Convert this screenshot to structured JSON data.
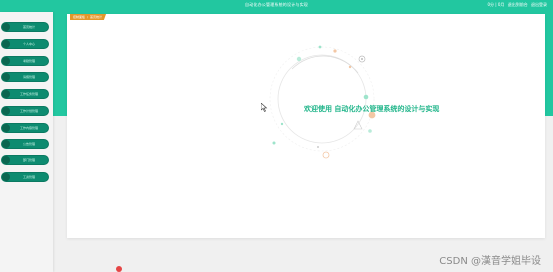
{
  "header": {
    "title": "自动化办公管理系统的设计与实现",
    "user_links": [
      "0分 | 0月",
      "退出到前台",
      "退出登录"
    ]
  },
  "sidebar": {
    "items": [
      {
        "label": "首页统计"
      },
      {
        "label": "个人中心"
      },
      {
        "label": "考勤管理"
      },
      {
        "label": "请假管理"
      },
      {
        "label": "工作任务管理"
      },
      {
        "label": "工作计划管理"
      },
      {
        "label": "工作内容管理"
      },
      {
        "label": "公告管理"
      },
      {
        "label": "部门管理"
      },
      {
        "label": "工资管理"
      }
    ]
  },
  "breadcrumb": {
    "items": [
      "控制面板",
      "首页统计"
    ]
  },
  "main": {
    "welcome_text": "欢迎使用 自动化办公管理系统的设计与实现"
  },
  "watermark": "CSDN @漢音学姐毕设",
  "colors": {
    "brand": "#22c7a0",
    "menu_bg": "#0d8b70",
    "breadcrumb_bg": "#e4972a",
    "welcome_text": "#20b58a"
  }
}
